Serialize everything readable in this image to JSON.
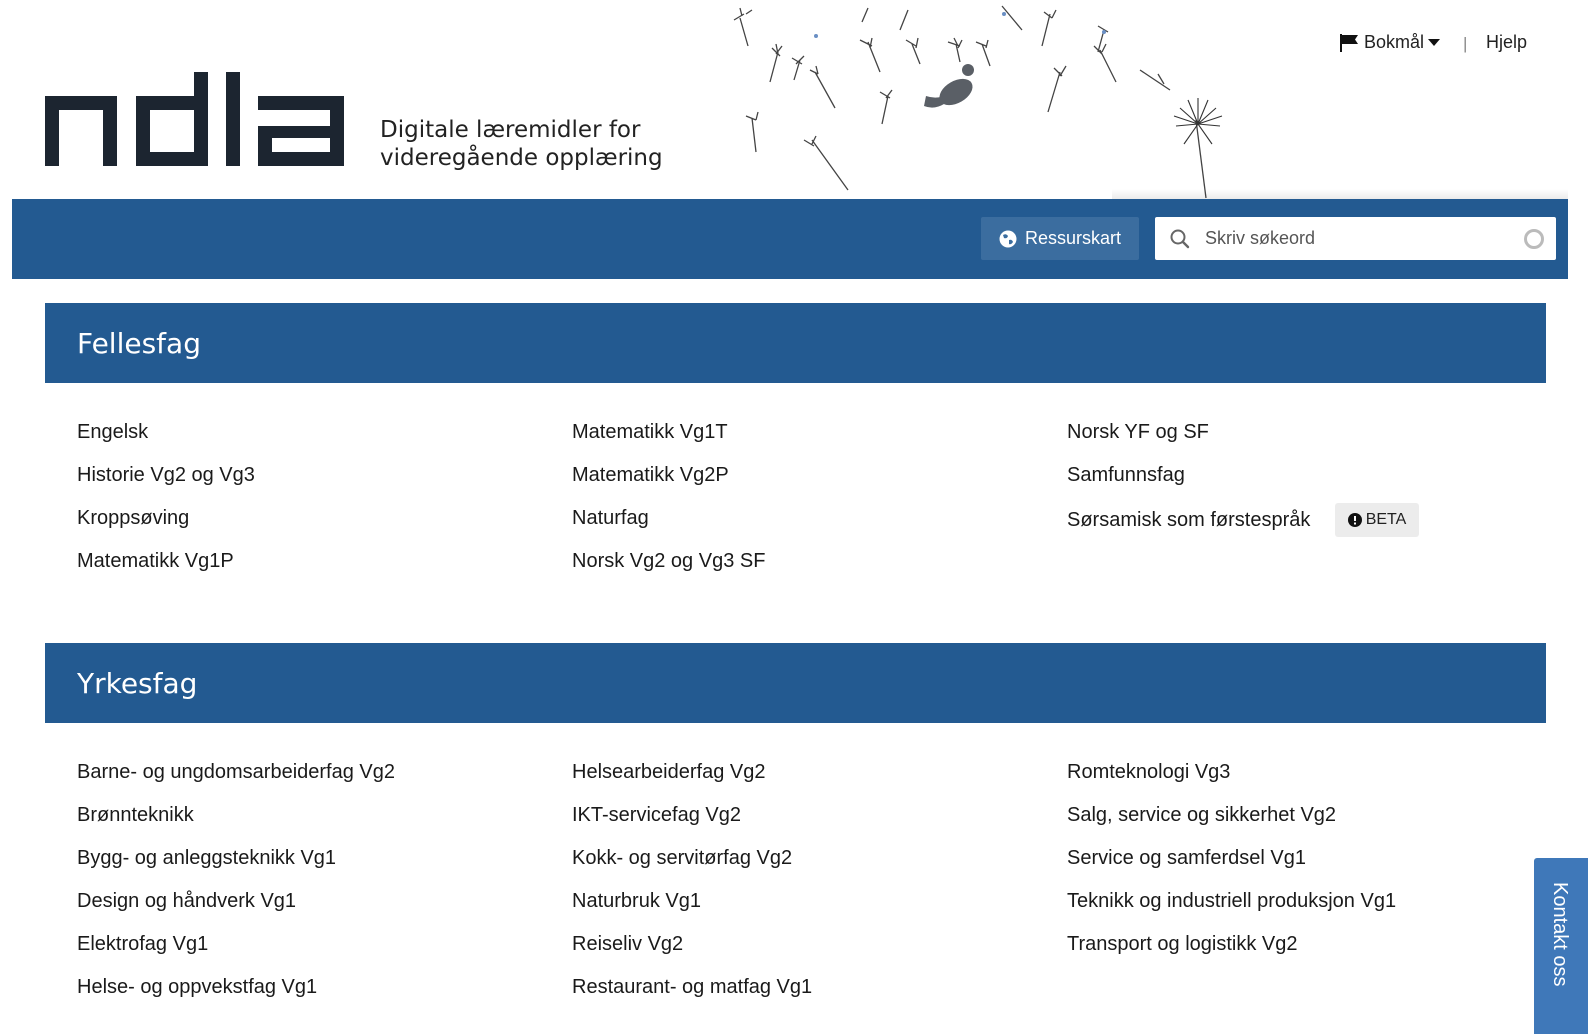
{
  "header": {
    "logo_text": "ndla",
    "tagline_line1": "Digitale læremidler for",
    "tagline_line2": "videregående opplæring",
    "language": "Bokmål",
    "separator": "|",
    "help": "Hjelp"
  },
  "navbar": {
    "ressurskart_label": "Ressurskart",
    "search_placeholder": "Skriv søkeord"
  },
  "fellesfag": {
    "title": "Fellesfag",
    "col1": [
      "Engelsk",
      "Historie Vg2 og Vg3",
      "Kroppsøving",
      "Matematikk Vg1P"
    ],
    "col2": [
      "Matematikk Vg1T",
      "Matematikk Vg2P",
      "Naturfag",
      "Norsk Vg2 og Vg3 SF"
    ],
    "col3": [
      "Norsk YF og SF",
      "Samfunnsfag",
      "Sørsamisk som førstespråk"
    ],
    "beta_label": "BETA"
  },
  "yrkesfag": {
    "title": "Yrkesfag",
    "col1": [
      "Barne- og ungdomsarbeiderfag Vg2",
      "Brønnteknikk",
      "Bygg- og anleggsteknikk Vg1",
      "Design og håndverk Vg1",
      "Elektrofag Vg1",
      "Helse- og oppvekstfag Vg1"
    ],
    "col2": [
      "Helsearbeiderfag Vg2",
      "IKT-servicefag Vg2",
      "Kokk- og servitørfag Vg2",
      "Naturbruk Vg1",
      "Reiseliv Vg2",
      "Restaurant- og matfag Vg1"
    ],
    "col3": [
      "Romteknologi Vg3",
      "Salg, service og sikkerhet Vg2",
      "Service og samferdsel Vg1",
      "Teknikk og industriell produksjon Vg1",
      "Transport og logistikk Vg2"
    ]
  },
  "kontakt": {
    "label": "Kontakt oss"
  },
  "colors": {
    "brand_blue": "#235a91",
    "button_blue": "#3b6d9f",
    "kontakt_blue": "#3f78b9"
  },
  "icons": [
    "flag-icon",
    "caret-down-icon",
    "globe-icon",
    "search-icon",
    "clear-icon",
    "info-icon"
  ]
}
